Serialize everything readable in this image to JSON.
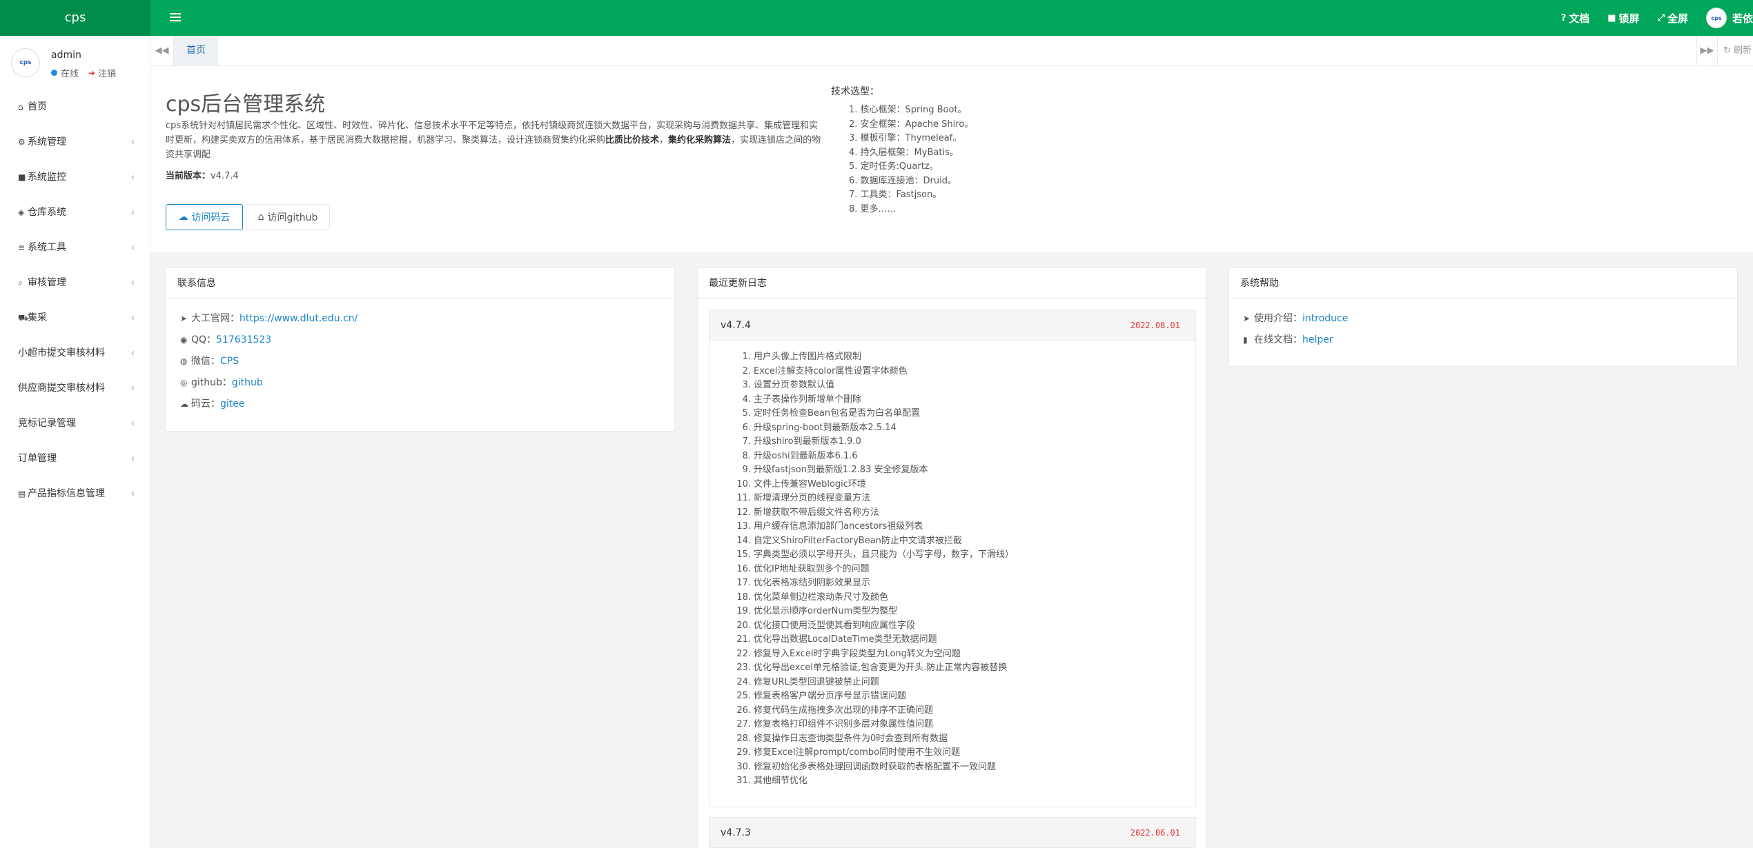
{
  "header": {
    "logo": "cps",
    "links": [
      {
        "icon": "question-icon",
        "glyph": "?",
        "label": "文档"
      },
      {
        "icon": "lock-icon",
        "glyph": "■",
        "label": "锁屏"
      },
      {
        "icon": "fullscreen-icon",
        "glyph": "⤢",
        "label": "全屏"
      }
    ],
    "user_name": "若依",
    "avatar_text": "cps",
    "brand_color": "#00a65a"
  },
  "sidebar": {
    "user": {
      "name": "admin",
      "status": "在线",
      "logout": "注销",
      "avatar_text": "cps"
    },
    "items": [
      {
        "label": "首页",
        "icon": "home-icon",
        "glyph": "⌂",
        "has_children": false
      },
      {
        "label": "系统管理",
        "icon": "gear-icon",
        "glyph": "⚙",
        "has_children": true
      },
      {
        "label": "系统监控",
        "icon": "video-icon",
        "glyph": "■",
        "has_children": true
      },
      {
        "label": "仓库系统",
        "icon": "cube-icon",
        "glyph": "◈",
        "has_children": true
      },
      {
        "label": "系统工具",
        "icon": "bars-icon",
        "glyph": "≡",
        "has_children": true
      },
      {
        "label": "审核管理",
        "icon": "search-icon",
        "glyph": "⌕",
        "has_children": true
      },
      {
        "label": "集采",
        "icon": "cart-icon",
        "glyph": "⛟",
        "has_children": true
      },
      {
        "label": "小超市提交审核材料",
        "icon": "",
        "glyph": "",
        "has_children": true
      },
      {
        "label": "供应商提交审核材料",
        "icon": "",
        "glyph": "",
        "has_children": true
      },
      {
        "label": "竞标记录管理",
        "icon": "",
        "glyph": "",
        "has_children": true
      },
      {
        "label": "订单管理",
        "icon": "",
        "glyph": "",
        "has_children": true
      },
      {
        "label": "产品指标信息管理",
        "icon": "book-icon",
        "glyph": "▤",
        "has_children": true
      }
    ]
  },
  "tabs": {
    "home": "首页",
    "refresh": "刷新"
  },
  "intro": {
    "title": "cps后台管理系统",
    "desc_1": "cps系统针对村镇居民需求个性化、区域性、时效性、碎片化、信息技术水平不足等特点，依托村镇级商贸连锁大数据平台，实现采购与消费数据共享、集成管理和实时更新，构建买卖双方的信用体系，基于居民消费大数据挖掘，机器学习、聚类算法，设计连锁商贸集约化采购",
    "desc_bold_1": "比质比价技术",
    "desc_2": "，",
    "desc_bold_2": "集约化采购算法",
    "desc_3": "，实现连锁店之间的物资共享调配",
    "version_label": "当前版本：",
    "version": "v4.7.4",
    "btn_gitee": "访问码云",
    "btn_github": "访问github",
    "tech_title": "技术选型：",
    "tech": [
      "核心框架：Spring Boot。",
      "安全框架：Apache Shiro。",
      "模板引擎：Thymeleaf。",
      "持久层框架：MyBatis。",
      "定时任务:Quartz。",
      "数据库连接池：Druid。",
      "工具类：Fastjson。",
      "更多……"
    ]
  },
  "contact": {
    "title": "联系信息",
    "items": [
      {
        "icon": "send-icon",
        "glyph": "➤",
        "label": "大工官网：",
        "value": "https://www.dlut.edu.cn/"
      },
      {
        "icon": "qq-icon",
        "glyph": "◉",
        "label": "QQ：",
        "value": "517631523"
      },
      {
        "icon": "wechat-icon",
        "glyph": "◍",
        "label": "微信：",
        "value": "CPS"
      },
      {
        "icon": "github-icon",
        "glyph": "◎",
        "label": "github：",
        "value": "github"
      },
      {
        "icon": "cloud-icon",
        "glyph": "☁",
        "label": "码云：",
        "value": "gitee"
      }
    ]
  },
  "changelog": {
    "title": "最近更新日志",
    "versions": [
      {
        "version": "v4.7.4",
        "date": "2022.08.01",
        "items": [
          "用户头像上传图片格式限制",
          "Excel注解支持color属性设置字体颜色",
          "设置分页参数默认值",
          "主子表操作列新增单个删除",
          "定时任务检查Bean包名是否为白名单配置",
          "升级spring-boot到最新版本2.5.14",
          "升级shiro到最新版本1.9.0",
          "升级oshi到最新版本6.1.6",
          "升级fastjson到最新版1.2.83 安全修复版本",
          "文件上传兼容Weblogic环境",
          "新增清理分页的线程变量方法",
          "新增获取不带后缀文件名称方法",
          "用户缓存信息添加部门ancestors祖级列表",
          "自定义ShiroFilterFactoryBean防止中文请求被拦截",
          "字典类型必须以字母开头，且只能为（小写字母，数字，下滑线）",
          "优化IP地址获取到多个的问题",
          "优化表格冻结列阴影效果显示",
          "优化菜单侧边栏滚动条尺寸及颜色",
          "优化显示顺序orderNum类型为整型",
          "优化接口使用泛型使其看到响应属性字段",
          "优化导出数据LocalDateTime类型无数据问题",
          "修复导入Excel时字典字段类型为Long转义为空问题",
          "优化导出excel单元格验证,包含变更为开头.防止正常内容被替换",
          "修复URL类型回退键被禁止问题",
          "修复表格客户端分页序号显示错误问题",
          "修复代码生成拖拽多次出现的排序不正确问题",
          "修复表格打印组件不识别多层对象属性值问题",
          "修复操作日志查询类型条件为0时会查到所有数据",
          "修复Excel注解prompt/combo同时使用不生效问题",
          "修复初始化多表格处理回调函数时获取的表格配置不一致问题",
          "其他细节优化"
        ]
      },
      {
        "version": "v4.7.3",
        "date": "2022.06.01",
        "items": []
      }
    ]
  },
  "help": {
    "title": "系统帮助",
    "items": [
      {
        "icon": "send-icon",
        "glyph": "➤",
        "label": "使用介绍：",
        "value": "introduce"
      },
      {
        "icon": "file-icon",
        "glyph": "▮",
        "label": "在线文档：",
        "value": "helper"
      }
    ]
  }
}
